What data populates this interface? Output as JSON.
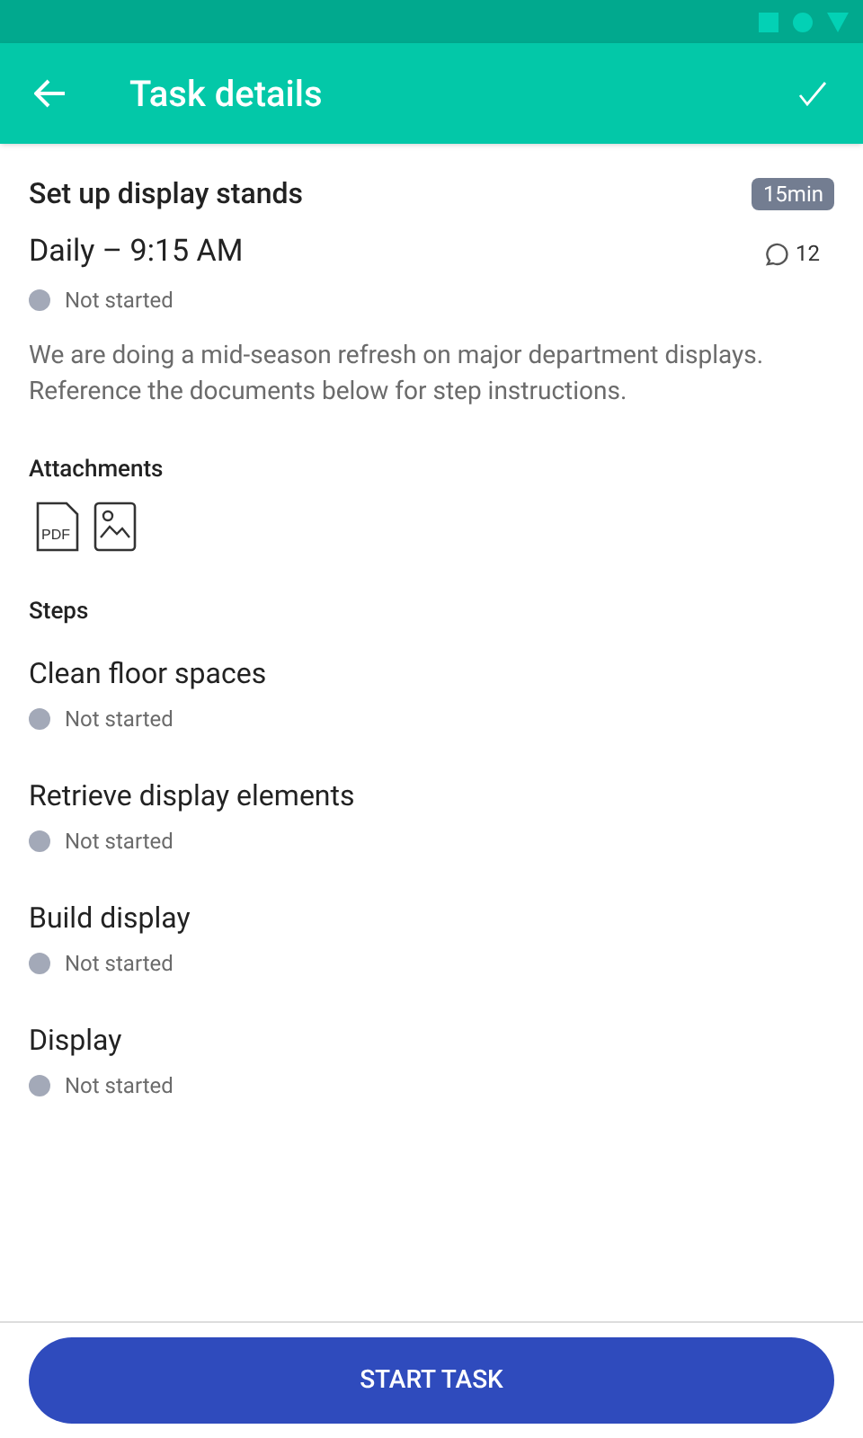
{
  "app_bar": {
    "title": "Task details"
  },
  "task": {
    "title": "Set up display stands",
    "duration": "15min",
    "schedule": "Daily – 9:15 AM",
    "comments": "12",
    "status": "Not started",
    "description": "We are doing a mid-season refresh on major department displays. Reference the documents below for step instructions."
  },
  "attachments": {
    "heading": "Attachments",
    "items": [
      {
        "kind": "pdf",
        "label": "PDF"
      },
      {
        "kind": "image"
      }
    ]
  },
  "steps": {
    "heading": "Steps",
    "items": [
      {
        "title": "Clean floor spaces",
        "status": "Not started"
      },
      {
        "title": "Retrieve display elements",
        "status": "Not started"
      },
      {
        "title": "Build display",
        "status": "Not started"
      },
      {
        "title": "Display",
        "status": "Not started"
      }
    ]
  },
  "action": {
    "label": "START TASK"
  }
}
